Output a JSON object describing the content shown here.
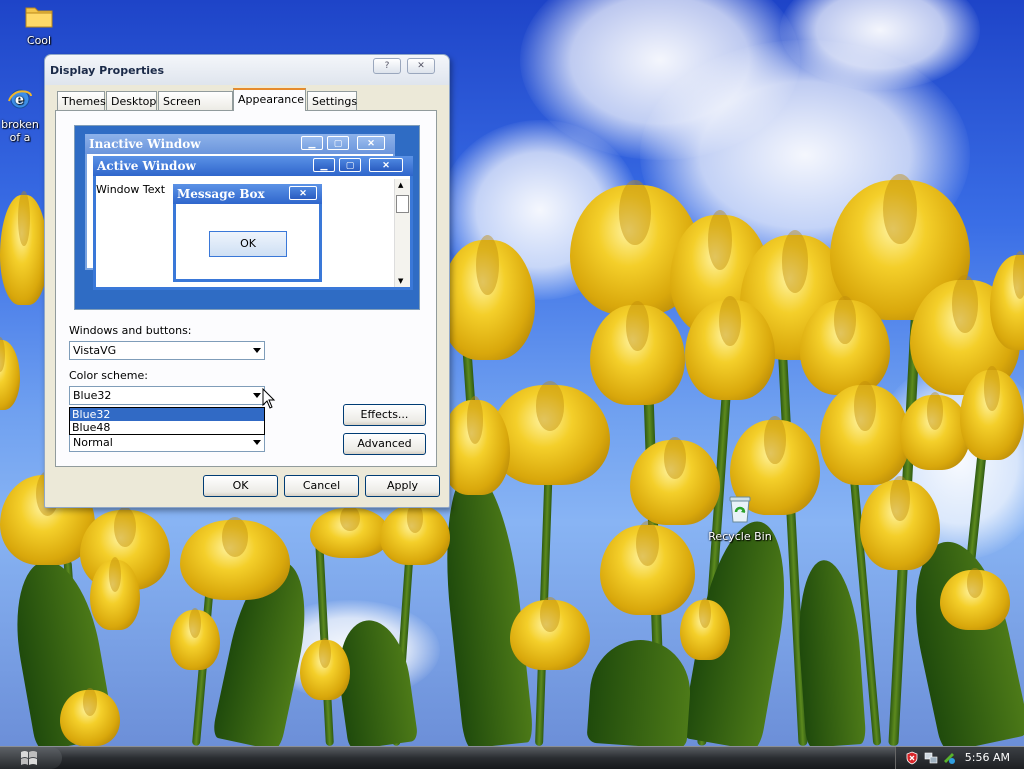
{
  "desktop": {
    "icons": [
      {
        "label": "Cool",
        "icon": "folder-icon"
      },
      {
        "label_line1": "broken",
        "label_line2": "of a",
        "icon": "internet-explorer-icon"
      },
      {
        "label": "Recycle Bin",
        "icon": "recycle-bin-icon"
      }
    ]
  },
  "dialog": {
    "title": "Display Properties",
    "help_button": "?",
    "close_button": "✕",
    "tabs": [
      {
        "label": "Themes"
      },
      {
        "label": "Desktop"
      },
      {
        "label": "Screen Saver"
      },
      {
        "label": "Appearance",
        "active": true
      },
      {
        "label": "Settings"
      }
    ],
    "preview": {
      "inactive_title": "Inactive Window",
      "active_title": "Active Window",
      "window_text": "Window Text",
      "message_box_title": "Message Box",
      "ok_label": "OK",
      "min_glyph": "▁",
      "max_glyph": "▢",
      "close_glyph": "✕"
    },
    "windows_and_buttons": {
      "label": "Windows and buttons:",
      "value": "VistaVG"
    },
    "color_scheme": {
      "label": "Color scheme:",
      "value": "Blue32",
      "options": [
        "Blue32",
        "Blue48"
      ],
      "highlighted": "Blue32"
    },
    "font_size": {
      "value": "Normal"
    },
    "effects_button": "Effects...",
    "advanced_button": "Advanced",
    "ok_button": "OK",
    "cancel_button": "Cancel",
    "apply_button": "Apply"
  },
  "taskbar": {
    "clock": "5:56 AM",
    "tray_icons": [
      "shield-icon",
      "network-icon",
      "safely-remove-icon"
    ]
  },
  "colors": {
    "sky": "#2f5fd8",
    "title_bar_active": "#3a78d8",
    "title_bar_inactive": "#7aa3e0",
    "selection": "#316ac5",
    "dialog_face": "#ece9d8",
    "tab_highlight": "#e68b2c"
  }
}
